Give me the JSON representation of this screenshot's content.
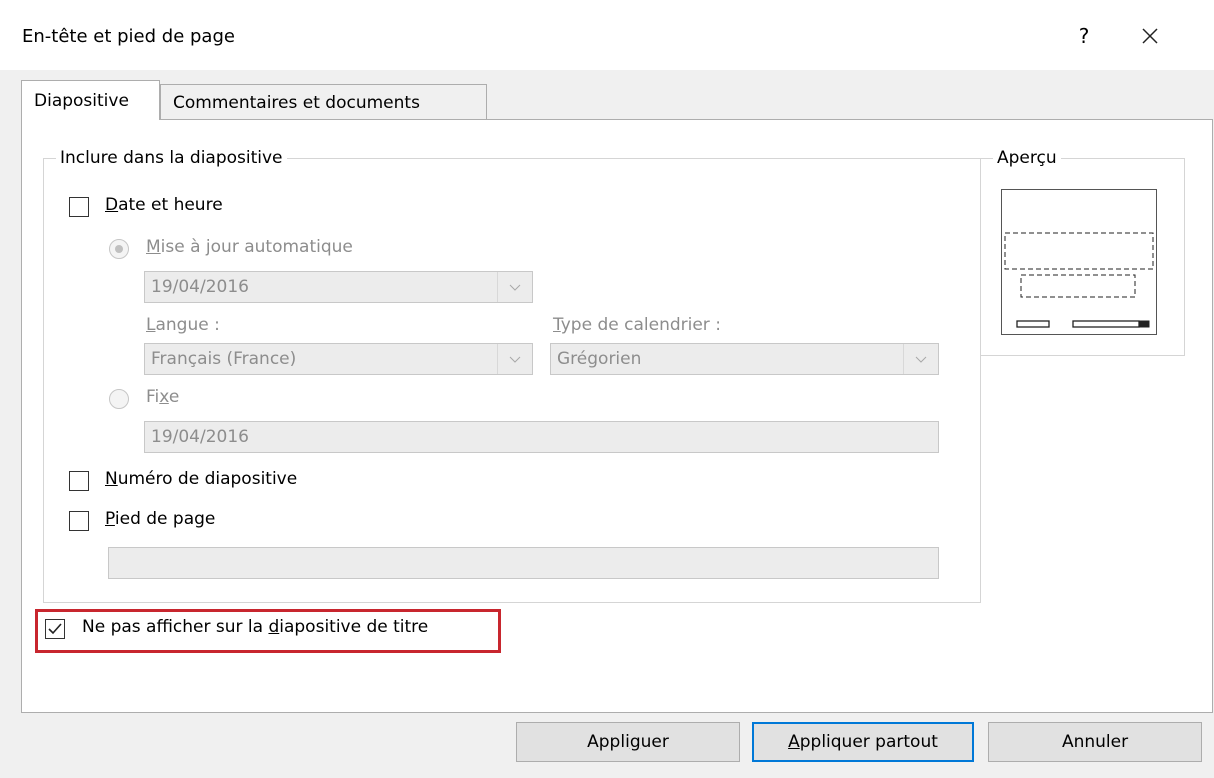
{
  "window": {
    "title": "En-tête et pied de page",
    "help_label": "?"
  },
  "tabs": [
    {
      "label": "Diapositive",
      "active": true
    },
    {
      "label": "Commentaires et documents",
      "active": false
    }
  ],
  "include_group": {
    "legend": "Inclure dans la diapositive",
    "date_time": {
      "label_first": "D",
      "label_rest": "ate et heure",
      "checked": false
    },
    "auto_update": {
      "label_first": "M",
      "label_rest": "ise à jour automatique",
      "selected": true,
      "value": "19/04/2016"
    },
    "language": {
      "label_first": "L",
      "label_rest": "angue :",
      "value": "Français (France)"
    },
    "calendar": {
      "label_first": "T",
      "label_rest": "ype de calendrier :",
      "value": "Grégorien"
    },
    "fixed": {
      "label_pre": "Fi",
      "label_u": "x",
      "label_post": "e",
      "selected": false,
      "value": "19/04/2016"
    },
    "slide_number": {
      "label_first": "N",
      "label_rest": "uméro de diapositive",
      "checked": false
    },
    "footer": {
      "label_first": "P",
      "label_rest": "ied de page",
      "checked": false,
      "value": ""
    }
  },
  "dont_show_title": {
    "label_pre": "Ne pas afficher sur la ",
    "label_u": "d",
    "label_post": "iapositive de titre",
    "checked": true
  },
  "preview": {
    "legend": "Aperçu"
  },
  "buttons": {
    "apply_pre": "Appli",
    "apply_u": "g",
    "apply_post": "uer",
    "apply_all_first": "A",
    "apply_all_rest": "ppliquer partout",
    "cancel": "Annuler"
  },
  "colors": {
    "highlight": "#c8262e",
    "default_button_border": "#0078d7"
  }
}
